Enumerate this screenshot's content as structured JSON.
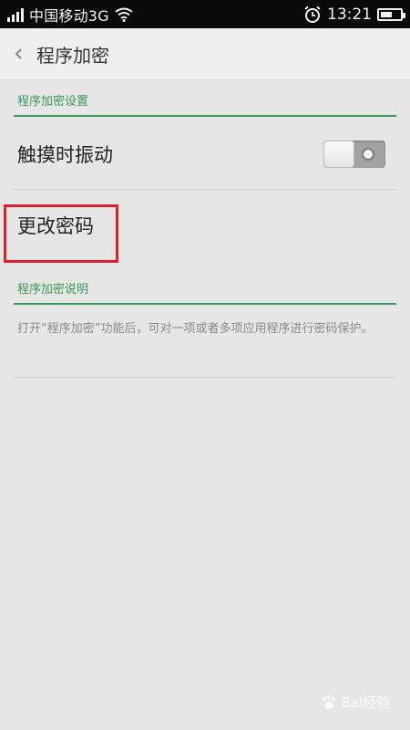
{
  "status_bar": {
    "carrier": "中国移动3G",
    "time": "13:21",
    "battery_level": 0.6,
    "icons": [
      "signal-icon",
      "wifi-icon",
      "alarm-icon",
      "battery-icon"
    ]
  },
  "header": {
    "title": "程序加密",
    "back_icon": "chevron-left-icon"
  },
  "section1": {
    "title": "程序加密设置",
    "touch_vibrate_label": "触摸时振动",
    "touch_vibrate_on": false,
    "change_password_label": "更改密码"
  },
  "section2": {
    "title": "程序加密说明",
    "description": "打开“程序加密”功能后，可对一项或者多项应用程序进行密码保护。"
  },
  "watermark": {
    "text": "Bai经验"
  },
  "colors": {
    "accent_green": "#3a9a5b",
    "highlight_red": "#e01d2a",
    "background": "#e6e6e6"
  }
}
